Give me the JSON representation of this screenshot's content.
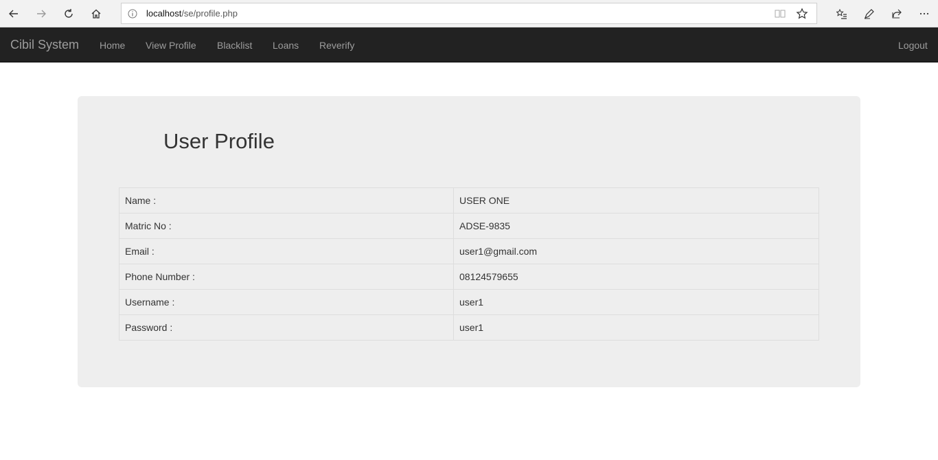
{
  "browser": {
    "url_host": "localhost",
    "url_path": "/se/profile.php"
  },
  "navbar": {
    "brand": "Cibil System",
    "items": [
      {
        "label": "Home"
      },
      {
        "label": "View Profile"
      },
      {
        "label": "Blacklist"
      },
      {
        "label": "Loans"
      },
      {
        "label": "Reverify"
      }
    ],
    "logout": "Logout"
  },
  "page": {
    "title": "User Profile"
  },
  "profile": {
    "rows": [
      {
        "label": "Name :",
        "value": "USER ONE"
      },
      {
        "label": "Matric No :",
        "value": "ADSE-9835"
      },
      {
        "label": "Email :",
        "value": "user1@gmail.com"
      },
      {
        "label": "Phone Number :",
        "value": "08124579655"
      },
      {
        "label": "Username :",
        "value": "user1"
      },
      {
        "label": "Password :",
        "value": "user1"
      }
    ]
  },
  "colors": {
    "navbar_bg": "#222222",
    "nav_text": "#9d9d9d",
    "jumbotron_bg": "#eeeeee"
  }
}
